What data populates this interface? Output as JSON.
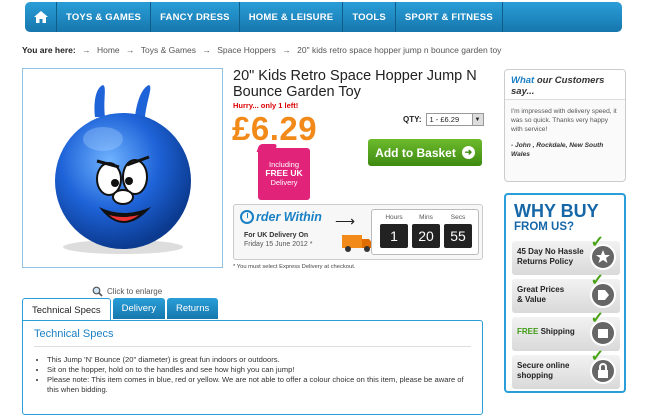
{
  "nav": {
    "items": [
      "TOYS & GAMES",
      "FANCY DRESS",
      "HOME & LEISURE",
      "TOOLS",
      "SPORT & FITNESS"
    ]
  },
  "breadcrumb": {
    "label": "You are here:",
    "items": [
      "Home",
      "Toys & Games",
      "Space Hoppers",
      "20\" kids retro space hopper jump n bounce garden toy"
    ]
  },
  "product": {
    "title": "20\" Kids Retro Space Hopper Jump N Bounce Garden Toy",
    "hurry": "Hurry... only 1 left!",
    "price": "£6.29",
    "qty_label": "QTY:",
    "qty_value": "1  -  £6.29",
    "add_to_basket": "Add to Basket",
    "enlarge": "Click to enlarge"
  },
  "delivery_badge": {
    "line1": "Including",
    "line2": "FREE UK",
    "line3": "Delivery"
  },
  "order_within": {
    "title": "rder Within",
    "sub1": "For UK Delivery On",
    "sub2": "Friday 15 June 2012 *",
    "hours_label": "Hours",
    "mins_label": "Mins",
    "secs_label": "Secs",
    "hours": "1",
    "mins": "20",
    "secs": "55",
    "note": "* You must select Express Delivery at checkout."
  },
  "testimonial": {
    "head_what": "What",
    "head_rest": " our Customers say...",
    "body": "I'm impressed with delivery speed, it was so quick. Thanks very happy with service!",
    "author": "- John , Rockdale, New South Wales"
  },
  "why_buy": {
    "title1": "WHY BUY",
    "title2": "FROM US?",
    "rows": [
      {
        "a": "45 Day No Hassle",
        "b": "Returns Policy",
        "icon": "star-icon"
      },
      {
        "a": "Great Prices",
        "b": "& Value",
        "icon": "tag-icon"
      },
      {
        "a": "FREE",
        "b": " Shipping",
        "icon": "box-icon"
      },
      {
        "a": "Secure online",
        "b": "shopping",
        "icon": "lock-icon"
      }
    ]
  },
  "tabs": [
    "Technical Specs",
    "Delivery",
    "Returns"
  ],
  "specs": {
    "heading": "Technical Specs",
    "bullets": [
      "This Jump 'N' Bounce (20\" diameter) is great fun indoors or outdoors.",
      "Sit on the hopper, hold on to the handles and see how high you can jump!",
      "Please note: This item comes in blue, red or yellow. We are not able to offer a colour choice on this item, please be aware of this when bidding."
    ]
  }
}
